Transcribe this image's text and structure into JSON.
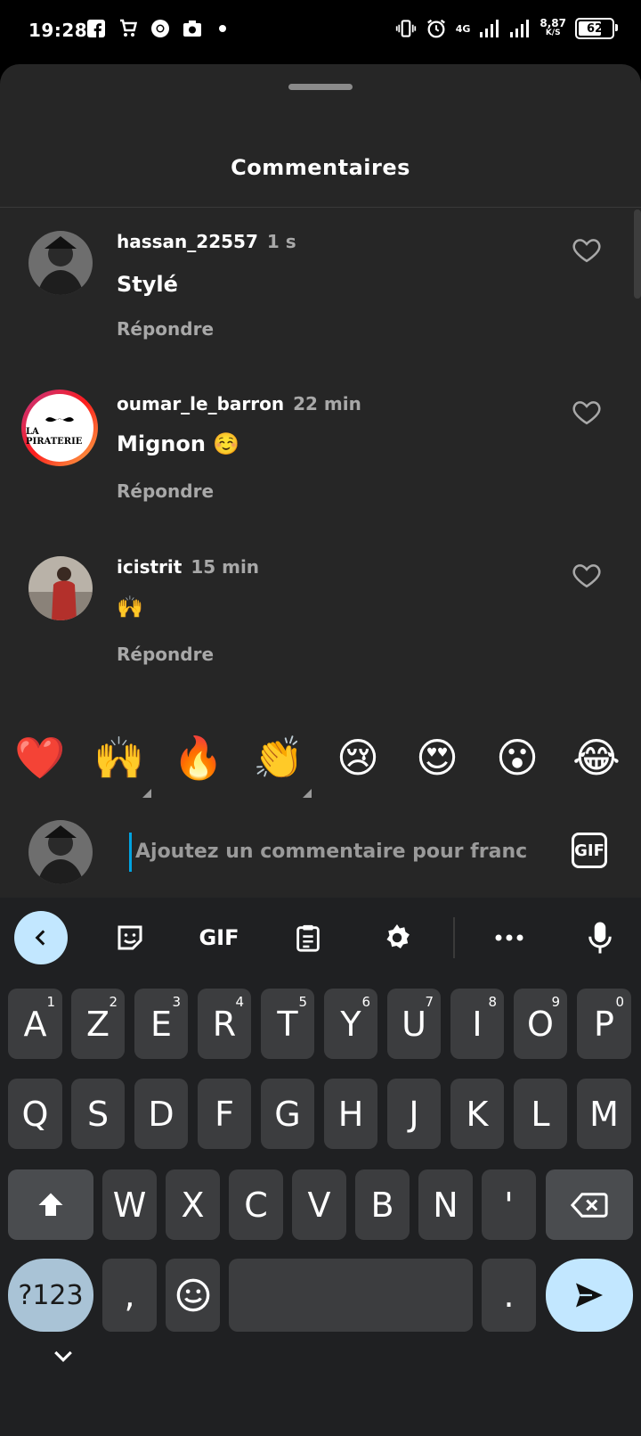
{
  "status_bar": {
    "time": "19:28",
    "network": "4G",
    "speed_value": "8,87",
    "speed_unit": "K/S",
    "battery": "62"
  },
  "sheet": {
    "title": "Commentaires"
  },
  "comments": [
    {
      "user": "hassan_22557",
      "time": "1 s",
      "text": "Stylé",
      "reply": "Répondre"
    },
    {
      "user": "oumar_le_barron",
      "time": "22 min",
      "text": "Mignon ☺️",
      "reply": "Répondre"
    },
    {
      "user": "icistrit",
      "time": "15 min",
      "text": "🙌",
      "reply": "Répondre"
    }
  ],
  "avatar_logo_text": "LA PIRATERIE",
  "reactions": [
    "❤️",
    "🙌",
    "🔥",
    "👏",
    "😢",
    "😍",
    "😮",
    "😂"
  ],
  "input": {
    "placeholder": "Ajoutez un commentaire pour franc",
    "gif_label": "GIF"
  },
  "keyboard": {
    "toolbar_gif": "GIF",
    "row1": [
      {
        "key": "A",
        "hint": "1"
      },
      {
        "key": "Z",
        "hint": "2"
      },
      {
        "key": "E",
        "hint": "3"
      },
      {
        "key": "R",
        "hint": "4"
      },
      {
        "key": "T",
        "hint": "5"
      },
      {
        "key": "Y",
        "hint": "6"
      },
      {
        "key": "U",
        "hint": "7"
      },
      {
        "key": "I",
        "hint": "8"
      },
      {
        "key": "O",
        "hint": "9"
      },
      {
        "key": "P",
        "hint": "0"
      }
    ],
    "row2": [
      "Q",
      "S",
      "D",
      "F",
      "G",
      "H",
      "J",
      "K",
      "L",
      "M"
    ],
    "row3": [
      "W",
      "X",
      "C",
      "V",
      "B",
      "N",
      "'"
    ],
    "symbols_key": "?123",
    "comma": ",",
    "period": "."
  },
  "colors": {
    "sheet_bg": "#262626",
    "keyboard_bg": "#1f2022",
    "key_bg": "#3c3d3f",
    "accent_blue": "#c2e7ff",
    "cursor": "#00a3e0"
  }
}
